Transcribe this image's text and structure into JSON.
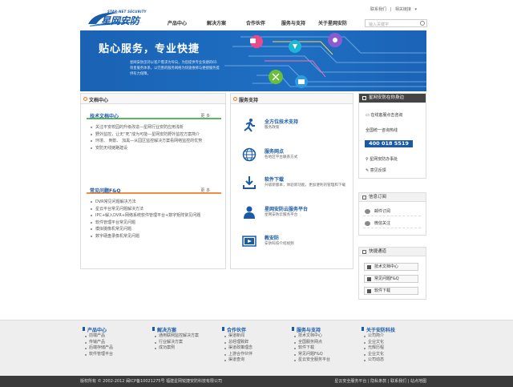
{
  "header": {
    "logo_en": "STAR-NET SECURITY",
    "logo_cn": "星网安防",
    "top_links": [
      "联系我们",
      "|",
      "相关链接"
    ],
    "nav": [
      "产品中心",
      "解决方案",
      "合作伙伴",
      "服务与支持",
      "关于星网安防"
    ],
    "search_placeholder": "输入关键字"
  },
  "banner": {
    "title": "贴心服务，专业快捷",
    "desc": "星网安防坚持以客户需求为导向，为您提供专业快捷的65项星服务体系，以完善的服务网络为快速维修与便捷服务提供有力保障。"
  },
  "left": {
    "title": "文档中心",
    "tech": {
      "title": "技术文档中心",
      "more": "更 多",
      "items": [
        "关注平安校园的升级改造—星网行业安防应用浅析",
        "野外监控，让无“死”成为可能—星网安防野外监控方案简介",
        "环境、 倒影、 加黑—从园区监控解决方案看网络监控的优势",
        "安防无线链路建设"
      ]
    },
    "faq": {
      "title": "常见问题F&Q",
      "more": "更 多",
      "items": [
        "DVR常见问题解决方法",
        "星云平台常见问题解决方法",
        "IPC+解入DVR+网络系统软件管理平台+数字矩阵常见问题",
        "软件管理平台常见问题",
        "模拟摄像机常见问题",
        "数字硬盘录像机常见问题"
      ]
    }
  },
  "middle": {
    "title": "服务支持",
    "services": [
      {
        "title": "全方位技术支持",
        "desc": "服务政策"
      },
      {
        "title": "服务网点",
        "desc": "各地区平台联系方式"
      },
      {
        "title": "软件下载",
        "desc": "升级新版本，体验新功能，更加便利的管理和下载"
      },
      {
        "title": "星网安防云服务平台",
        "desc": "星网安防云服务平台"
      },
      {
        "title": "教安防",
        "desc": "安防科技介绍视频"
      }
    ]
  },
  "right": {
    "contact_head": "星网安防在你身边",
    "online": "在线客服点击咨询",
    "hotline_label": "全国统一咨询热线",
    "phone": "400 018 5519",
    "office": "星网安防办事处",
    "feedback": "意见反馈",
    "subscribe_head": "信息订阅",
    "subscribe": [
      "邮件订阅",
      "微信关注"
    ],
    "quick_head": "快捷通道",
    "quick": [
      "技术文档中心",
      "常见问题F&Q",
      "软件下载"
    ]
  },
  "footer": {
    "columns": [
      {
        "title": "产品中心",
        "items": [
          "前端产品",
          "传输产品",
          "后端存储产品",
          "软件管理平台"
        ]
      },
      {
        "title": "解决方案",
        "items": [
          "通用联网监控解决方案",
          "行业解决方案",
          "成功案例"
        ]
      },
      {
        "title": "合作伙伴",
        "items": [
          "渠道新闻",
          "总经理致辞",
          "渠道政策理念",
          "上游合作伙伴",
          "渠道查询"
        ]
      },
      {
        "title": "服务与支持",
        "items": [
          "技术文档中心",
          "全国服务网点",
          "软件下载",
          "常见问题F&Q",
          "星云安全服务平台"
        ]
      },
      {
        "title": "关于安防科技",
        "items": [
          "公司简介",
          "企业文化",
          "光辉历程",
          "企业文化",
          "公司动态"
        ]
      }
    ],
    "copyright": "版权所有 © 2002-2012 闽ICP备10021275号 福建星网锐捷安防科技有限公司",
    "links": "星云安全服务平台 | 隐私条款 | 联系我们 | 站点地图"
  },
  "colors": {
    "brand": "#1a5aa6",
    "accent_green": "#5cb85c",
    "accent_orange": "#f08c3a"
  }
}
